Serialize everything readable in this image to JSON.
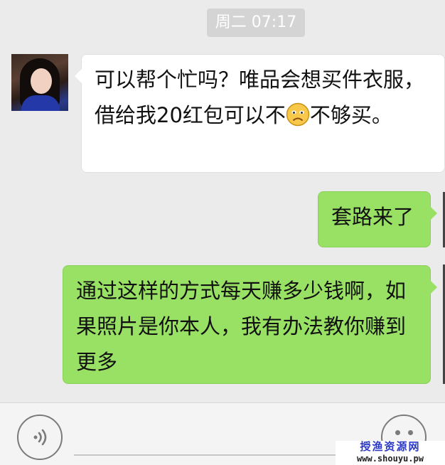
{
  "chat": {
    "timestamp": "周二 07:17",
    "messages": [
      {
        "direction": "incoming",
        "text_before_emoji": "可以帮个忙吗？唯品会想买件衣服，借给我20红包可以不",
        "emoji": "frown-emoji",
        "text_after_emoji": "不够买。"
      },
      {
        "direction": "outgoing",
        "text": "套路来了"
      },
      {
        "direction": "outgoing",
        "text": "通过这样的方式每天赚多少钱啊，如果照片是你本人，我有办法教你赚到更多"
      }
    ]
  },
  "input_bar": {
    "voice_icon": "voice-icon",
    "emoji_icon": "emoji-face-icon"
  },
  "watermark": {
    "title": "授渔资源网",
    "url": "www.shouyu.pw"
  },
  "colors": {
    "background": "#ebebeb",
    "incoming_bubble": "#ffffff",
    "outgoing_bubble": "#98e165",
    "timestamp_pill": "#d4d4d4",
    "watermark_title": "#2b39c8"
  }
}
